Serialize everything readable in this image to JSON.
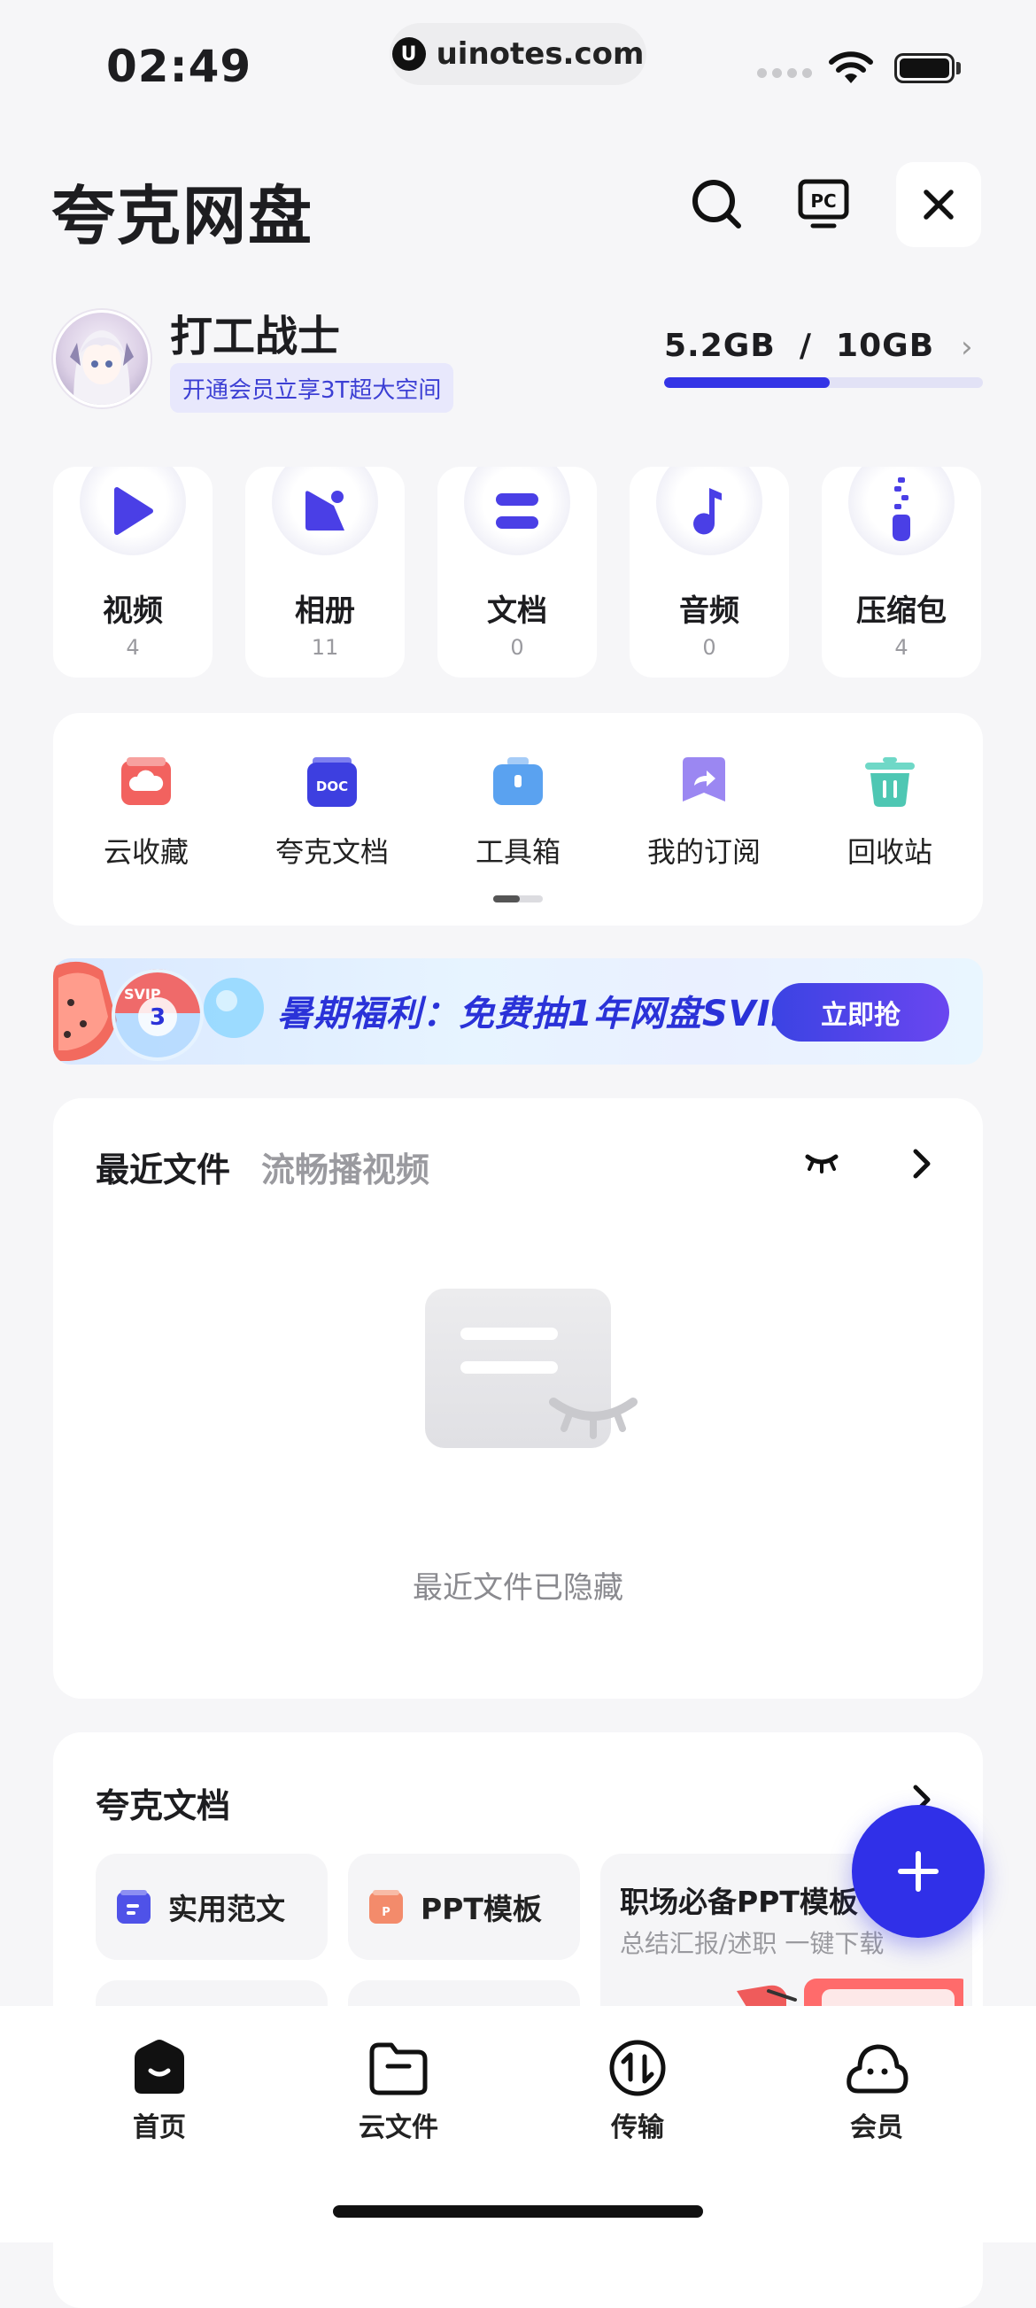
{
  "status_bar": {
    "time": "02:49",
    "url": "uinotes.com",
    "url_logo": "U"
  },
  "header": {
    "title": "夸克网盘",
    "icons": [
      "search-icon",
      "pc-icon",
      "close-icon"
    ]
  },
  "user": {
    "name": "打工战士",
    "vip_promo": "开通会员立享3T超大空间",
    "storage_used": "5.2GB",
    "storage_total": "10GB",
    "storage_text": "5.2GB  /  10GB",
    "storage_fraction": 0.52
  },
  "categories": [
    {
      "label": "视频",
      "count": "4"
    },
    {
      "label": "相册",
      "count": "11"
    },
    {
      "label": "文档",
      "count": "0"
    },
    {
      "label": "音频",
      "count": "0"
    },
    {
      "label": "压缩包",
      "count": "4"
    }
  ],
  "tools": [
    {
      "label": "云收藏"
    },
    {
      "label": "夸克文档",
      "icon_text": "DOC"
    },
    {
      "label": "工具箱"
    },
    {
      "label": "我的订阅"
    },
    {
      "label": "回收站"
    }
  ],
  "banner": {
    "text": "暑期福利：免费抽1年网盘SVIP",
    "button": "立即抢",
    "badge_text": "SVIP"
  },
  "recent": {
    "title": "最近文件",
    "subtitle": "流畅播视频",
    "empty_text": "最近文件已隐藏"
  },
  "docs": {
    "title": "夸克文档",
    "chips": [
      "实用范文",
      "PPT模板"
    ],
    "promo_title": "职场必备PPT模板",
    "promo_sub": "总结汇报/述职 一键下载"
  },
  "tabbar": [
    {
      "label": "首页",
      "active": true
    },
    {
      "label": "云文件"
    },
    {
      "label": "传输"
    },
    {
      "label": "会员"
    }
  ],
  "colors": {
    "accent": "#3434e6",
    "background": "#f6f6f8",
    "card": "#ffffff",
    "vip_text": "#3c3fd4"
  }
}
